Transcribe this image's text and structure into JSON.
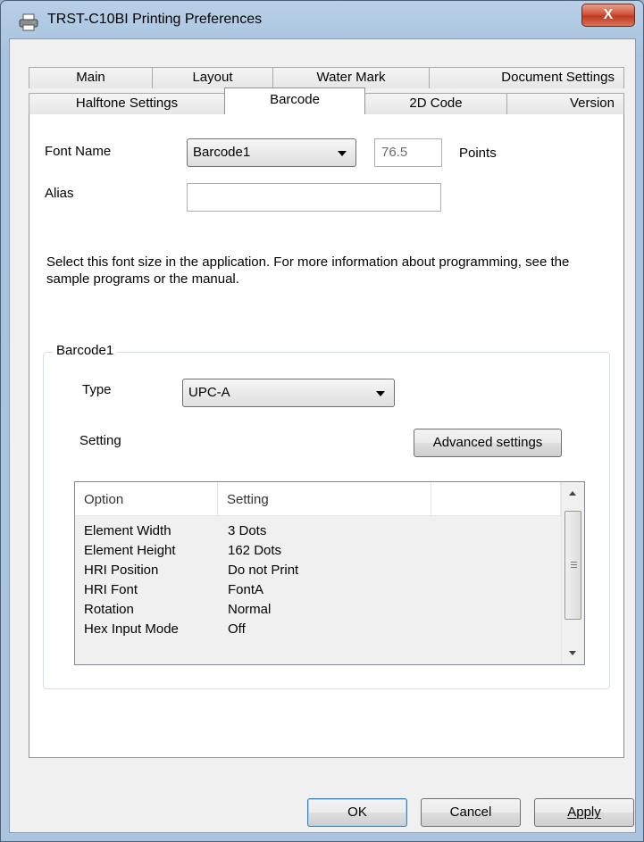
{
  "window": {
    "title": "TRST-C10BI Printing Preferences",
    "close_label": "X"
  },
  "tabs": {
    "row1": [
      "Main",
      "Layout",
      "Water Mark",
      "Document Settings"
    ],
    "row2": [
      "Halftone Settings",
      "Barcode",
      "2D Code",
      "Version"
    ],
    "active": "Barcode"
  },
  "font": {
    "label": "Font Name",
    "selected": "Barcode1",
    "points_value": "76.5",
    "points_label": "Points"
  },
  "alias": {
    "label": "Alias",
    "value": ""
  },
  "info_text": "Select this font size in the application. For more information about programming, see the sample programs or the manual.",
  "group": {
    "title": "Barcode1",
    "type_label": "Type",
    "type_value": "UPC-A",
    "setting_label": "Setting",
    "advanced_button": "Advanced settings"
  },
  "listview": {
    "columns": [
      "Option",
      "Setting",
      ""
    ],
    "rows": [
      {
        "option": "Element Width",
        "setting": "3 Dots"
      },
      {
        "option": "Element Height",
        "setting": "162 Dots"
      },
      {
        "option": "HRI Position",
        "setting": "Do not Print"
      },
      {
        "option": "HRI Font",
        "setting": "FontA"
      },
      {
        "option": "Rotation",
        "setting": "Normal"
      },
      {
        "option": "Hex Input Mode",
        "setting": "Off"
      }
    ]
  },
  "buttons": {
    "ok": "OK",
    "cancel": "Cancel",
    "apply": "Apply"
  }
}
